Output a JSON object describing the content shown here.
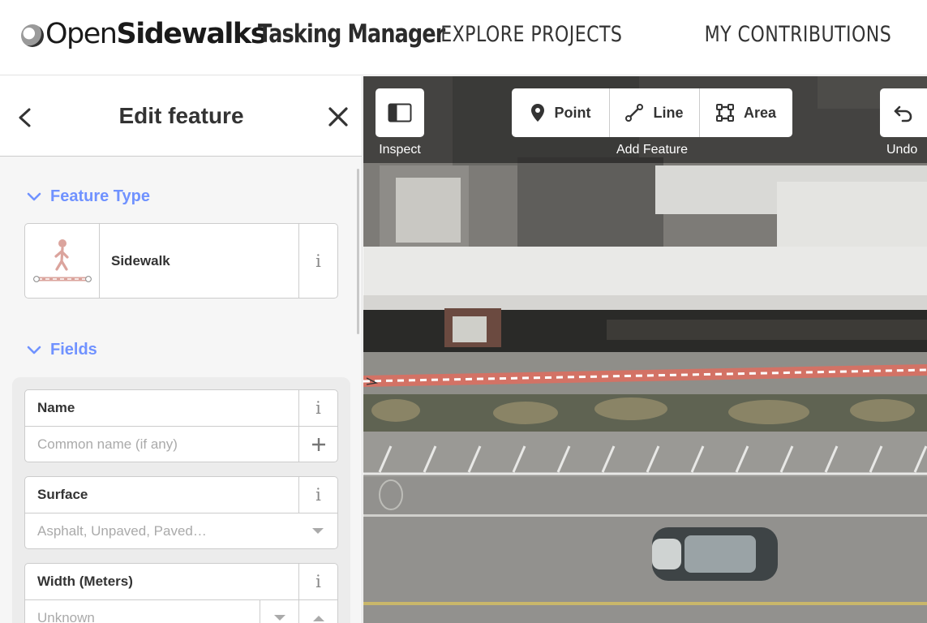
{
  "header": {
    "logo_prefix": "Open",
    "logo_bold": "Sidewalks",
    "app_title": "Tasking Manager",
    "nav": [
      {
        "label": "EXPLORE PROJECTS"
      },
      {
        "label": "MY CONTRIBUTIONS"
      }
    ]
  },
  "sidebar": {
    "title": "Edit feature",
    "back_icon": "chevron-left-icon",
    "close_icon": "close-icon",
    "feature_type": {
      "heading": "Feature Type",
      "preset_name": "Sidewalk",
      "preset_icon": "pedestrian-sidewalk-icon"
    },
    "fields": {
      "heading": "Fields",
      "items": [
        {
          "label": "Name",
          "placeholder": "Common name (if any)",
          "action_icon": "plus-icon"
        },
        {
          "label": "Surface",
          "placeholder": "Asphalt, Unpaved, Paved…",
          "action_icon": "caret-down-icon"
        },
        {
          "label": "Width (Meters)",
          "placeholder": "Unknown",
          "action_icon": "stepper-icon"
        }
      ]
    }
  },
  "map_toolbar": {
    "inspect_label": "Inspect",
    "add_feature_label": "Add Feature",
    "undo_label": "Undo",
    "modes": [
      {
        "label": "Point",
        "icon": "map-pin-icon"
      },
      {
        "label": "Line",
        "icon": "line-icon"
      },
      {
        "label": "Area",
        "icon": "area-icon"
      }
    ]
  },
  "colors": {
    "accent": "#7092ff",
    "selected_way": "#e06e5f"
  }
}
